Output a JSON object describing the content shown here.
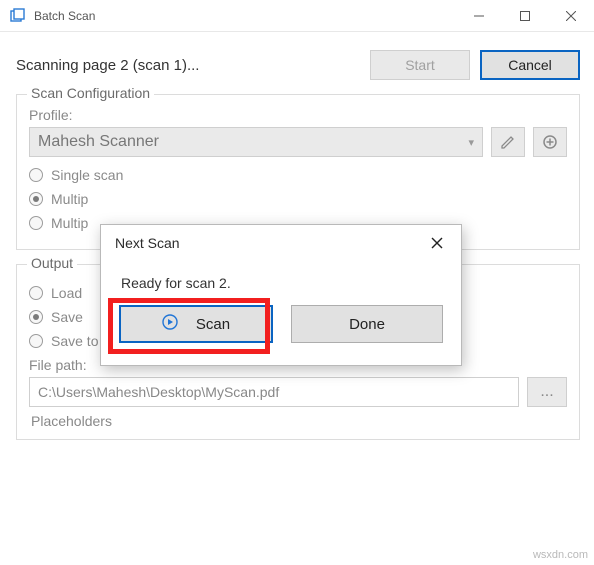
{
  "window": {
    "title": "Batch Scan",
    "status": "Scanning page 2 (scan 1)...",
    "start_label": "Start",
    "cancel_label": "Cancel"
  },
  "config_group": {
    "title": "Scan Configuration",
    "profile_label": "Profile:",
    "profile_value": "Mahesh Scanner",
    "opt_single": "Single scan",
    "opt_multi1": "Multip",
    "opt_multi2": "Multip"
  },
  "output_group": {
    "title": "Output",
    "opt_load": "Load",
    "opt_save_single_partial": "Save",
    "opt_save_multi": "Save to multiple files",
    "filepath_label": "File path:",
    "filepath_value": "C:\\Users\\Mahesh\\Desktop\\MyScan.pdf",
    "browse_label": "...",
    "placeholders_label": "Placeholders"
  },
  "modal": {
    "title": "Next Scan",
    "message": "Ready for scan 2.",
    "scan_label": "Scan",
    "done_label": "Done"
  },
  "watermark": "wsxdn.com"
}
